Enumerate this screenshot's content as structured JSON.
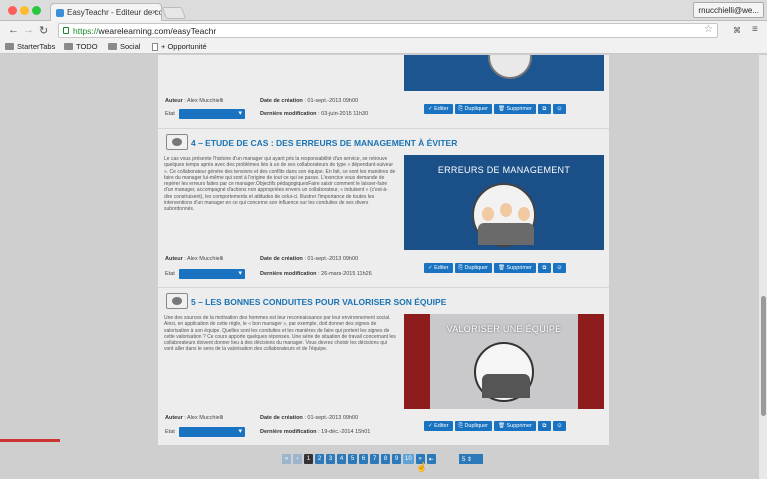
{
  "browser": {
    "tab_title": "EasyTeachr - Editeur de co",
    "tab_close": "×",
    "user": "rnucchielli@we...",
    "url_scheme": "https://",
    "url_rest": "wearelearning.com/easyTeachr",
    "bookmarks": [
      "StarterTabs",
      "TODO",
      "Social",
      "+ Opportunité"
    ],
    "star": "☆"
  },
  "card0": {
    "author_label": "Auteur",
    "author": ": Alex Mucchielli",
    "etat_label": "Etat",
    "created_label": "Date de création",
    "created": ": 01-sept.-2013 09h00",
    "modified_label": "Dernière modification",
    "modified": ": 03-juin-2015 11h30"
  },
  "card1": {
    "title": "4 – ETUDE DE CAS : DES ERREURS DE MANAGEMENT À ÉVITER",
    "desc": "Le cas vous présente l'histoire d'un manager qui ayant pris la responsabilité d'un service, se retrouve quelques temps après avec des problèmes liés à un de ses collaborateurs de type « dépendant-suiveur ». Ce collaborateur génère des tensions et des conflits dans son équipe. En fait, ce sont les manières de faire du manager lui-même qui sont à l'origine de tout ce qui se passe. L'exercice vous demande de repérer les erreurs faites par ce manager.Objectifs pédagogiquesFaire saisir comment le laisser-faire d'un manager, accompagné d'actions non appropriées envers un collaborateur, « induisent » (c'est-à-dire construisent), les comportements et attitudes de celui-ci. Illustrer l'importance de toutes les interventions d'un manager en ce qui concerne son influence sur les conduites de ses divers subordonnés.",
    "thumb_title": "ERREURS DE MANAGEMENT",
    "author_label": "Auteur",
    "author": ": Alex Mucchielli",
    "etat_label": "Etat",
    "created_label": "Date de création",
    "created": ": 01-sept.-2013 09h00",
    "modified_label": "Dernière modification",
    "modified": ": 26-mars-2015 11h26"
  },
  "card2": {
    "title": "5 – LES BONNES CONDUITES POUR VALORISER SON ÉQUIPE",
    "desc": "Une des sources de la motivation des hommes est leur reconnaissance par leur environnement social. Ainsi, en application de cette règle, le « bon manager », par exemple, doit donner des signes de valorisation à son équipe. Quelles sont les conduites et les manières de faire qui portent les signes de cette valorisation ? Ce cours apporte quelques réponses. Une série de situation de travail concernant les collaborateurs doivent donner lieu à des décisions du manager. Vous devrez choisir les décisions qui vont aller dans le sens de la valorisation des collaborateurs et de l'équipe.",
    "thumb_title": "VALORISER UNE ÉQUIPE",
    "author_label": "Auteur",
    "author": ": Alex Mucchielli",
    "etat_label": "Etat",
    "created_label": "Date de création",
    "created": ": 01-sept.-2013 09h00",
    "modified_label": "Dernière modification",
    "modified": ": 19-déc.-2014 15h01"
  },
  "actions": {
    "edit": "✓ Editer",
    "duplicate": "⎘ Dupliquer",
    "delete": "🗑 Supprimer",
    "sq1": "⧉",
    "sq2": "⊙"
  },
  "pager": {
    "first": "«",
    "prev": "‹",
    "pages": [
      "1",
      "2",
      "3",
      "4",
      "5",
      "6",
      "7",
      "8",
      "9",
      "10"
    ],
    "next": "»",
    "last": "⇤",
    "per_page": "5 ⇕"
  },
  "colors": {
    "accent": "#1a73c0",
    "title": "#1a73b4"
  }
}
